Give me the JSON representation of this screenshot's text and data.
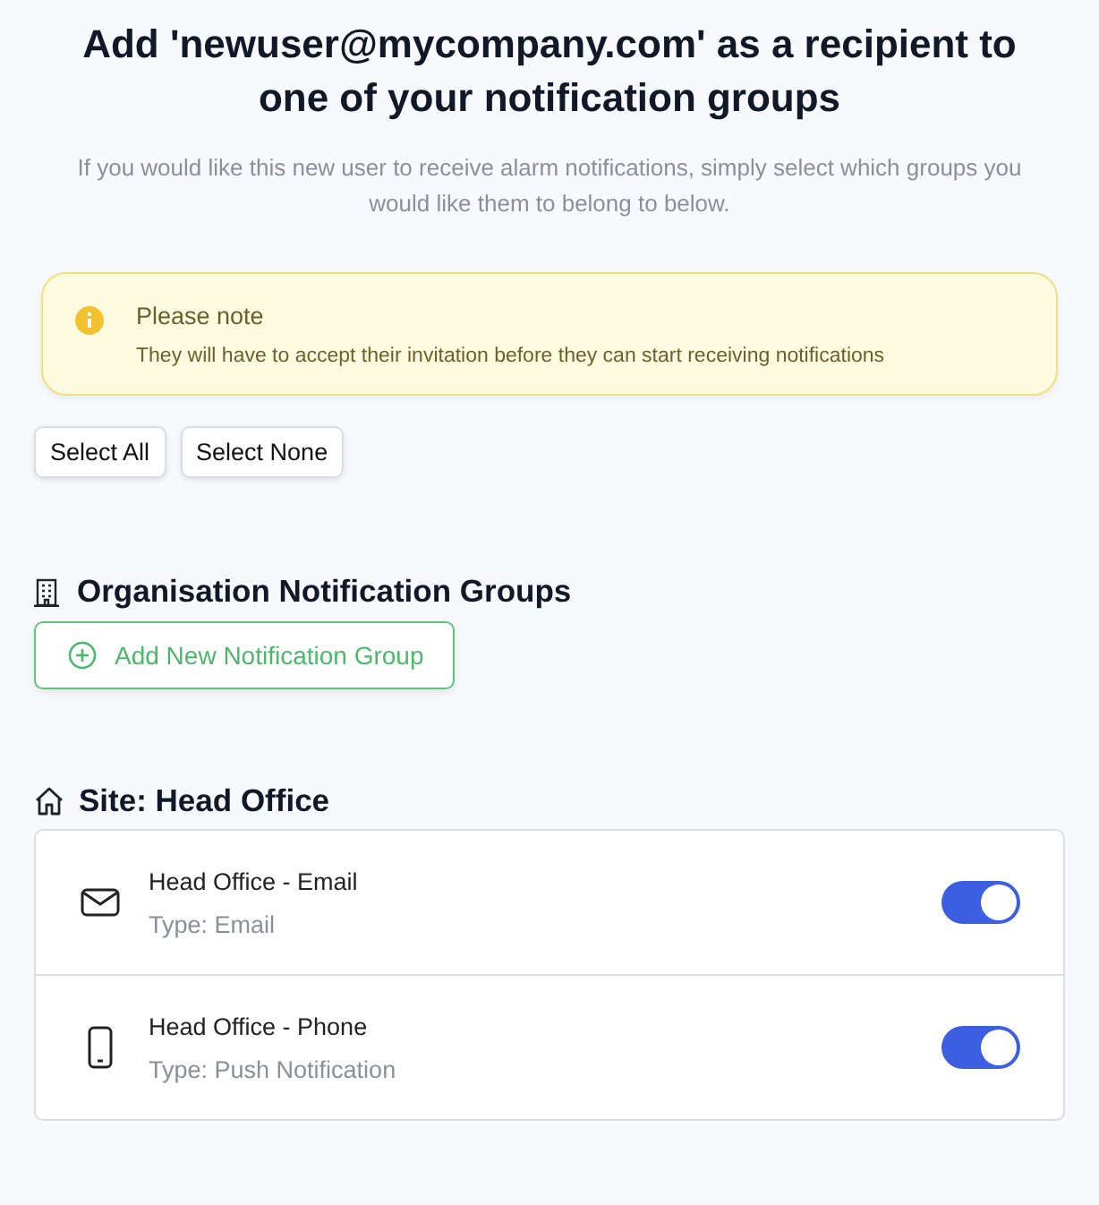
{
  "title": "Add 'newuser@mycompany.com' as a recipient to one of your notification groups",
  "subtitle": "If you would like this new user to receive alarm notifications, simply select which groups you would like them to belong to below.",
  "notice": {
    "title": "Please note",
    "text": "They will have to accept their invitation before they can start receiving notifications"
  },
  "selection_buttons": [
    "Select All",
    "Select None"
  ],
  "organisation_section": {
    "heading": "Organisation Notification Groups",
    "add_button": "Add New Notification Group"
  },
  "site_section": {
    "heading": "Site: Head Office",
    "groups": [
      {
        "kind": "email",
        "name": "Head Office - Email",
        "type": "Type: Email",
        "on": true
      },
      {
        "kind": "phone",
        "name": "Head Office - Phone",
        "type": "Type: Push Notification",
        "on": true
      }
    ]
  }
}
